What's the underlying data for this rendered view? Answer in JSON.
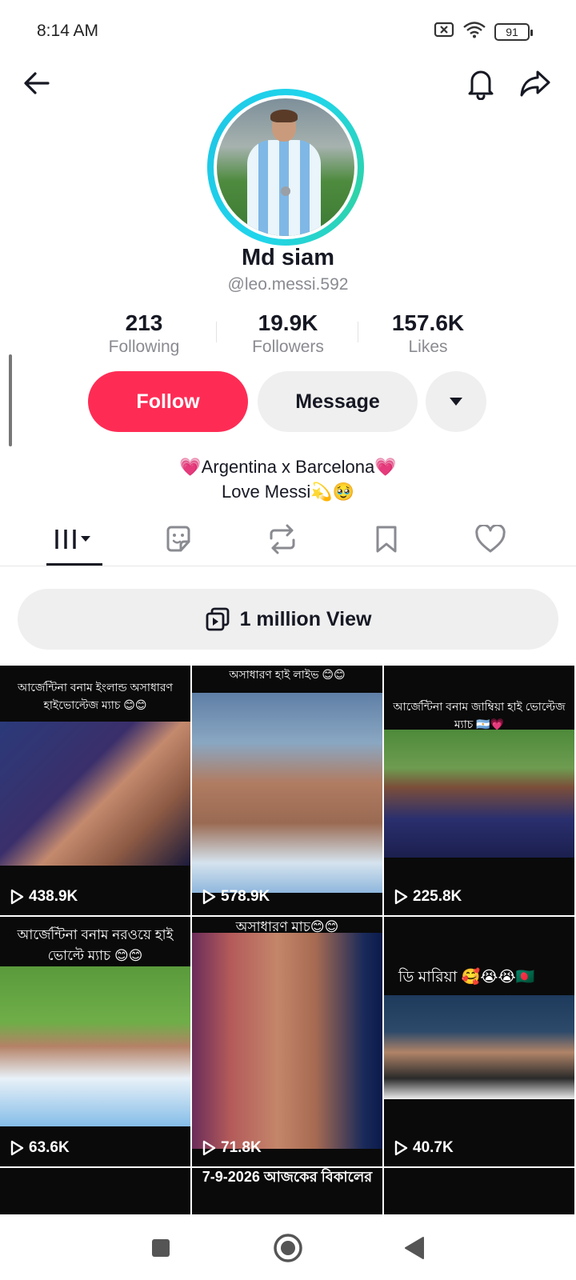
{
  "status": {
    "time": "8:14 AM",
    "battery": "91"
  },
  "profile": {
    "display_name": "Md siam",
    "handle": "@leo.messi.592",
    "stats": [
      {
        "value": "213",
        "label": "Following"
      },
      {
        "value": "19.9K",
        "label": "Followers"
      },
      {
        "value": "157.6K",
        "label": "Likes"
      }
    ],
    "follow_label": "Follow",
    "message_label": "Message",
    "bio_line1": "💗Argentina x Barcelona💗",
    "bio_line2": "Love Messi💫🥹"
  },
  "tabs": [
    "videos-tab",
    "stickers-tab",
    "reposts-tab",
    "favorites-tab",
    "liked-tab"
  ],
  "playlist": {
    "label": "1 million View"
  },
  "videos": [
    {
      "caption": "আর্জেন্টিনা বনাম ইংলান্ড অসাধারণ হাইভোল্টেজ ম্যাচ 😊😊",
      "views": "438.9K"
    },
    {
      "caption": "অসাধারণ হাই লাইভ 😊😊",
      "views": "578.9K"
    },
    {
      "caption": "আর্জেন্টিনা বনাম জাম্বিয়া হাই ভোল্টেজ ম্যাচ 🇦🇷💗",
      "views": "225.8K"
    },
    {
      "caption": "আর্জেন্টিনা বনাম নরওয়ে হাই ভোল্টে ম্যাচ 😊😊",
      "views": "63.6K"
    },
    {
      "caption": "অসাধারণ মাচ😊😊",
      "views": "71.8K"
    },
    {
      "caption": "ডি মারিয়া 🥰😭😭🇧🇩",
      "views": "40.7K"
    },
    {
      "caption": "",
      "views": ""
    },
    {
      "caption": "7-9-2026 আজকের বিকালের",
      "views": ""
    },
    {
      "caption": "",
      "views": ""
    }
  ],
  "colors": {
    "accent": "#fe2c55",
    "ring": "#20d5ec",
    "button_bg": "#efefef"
  }
}
